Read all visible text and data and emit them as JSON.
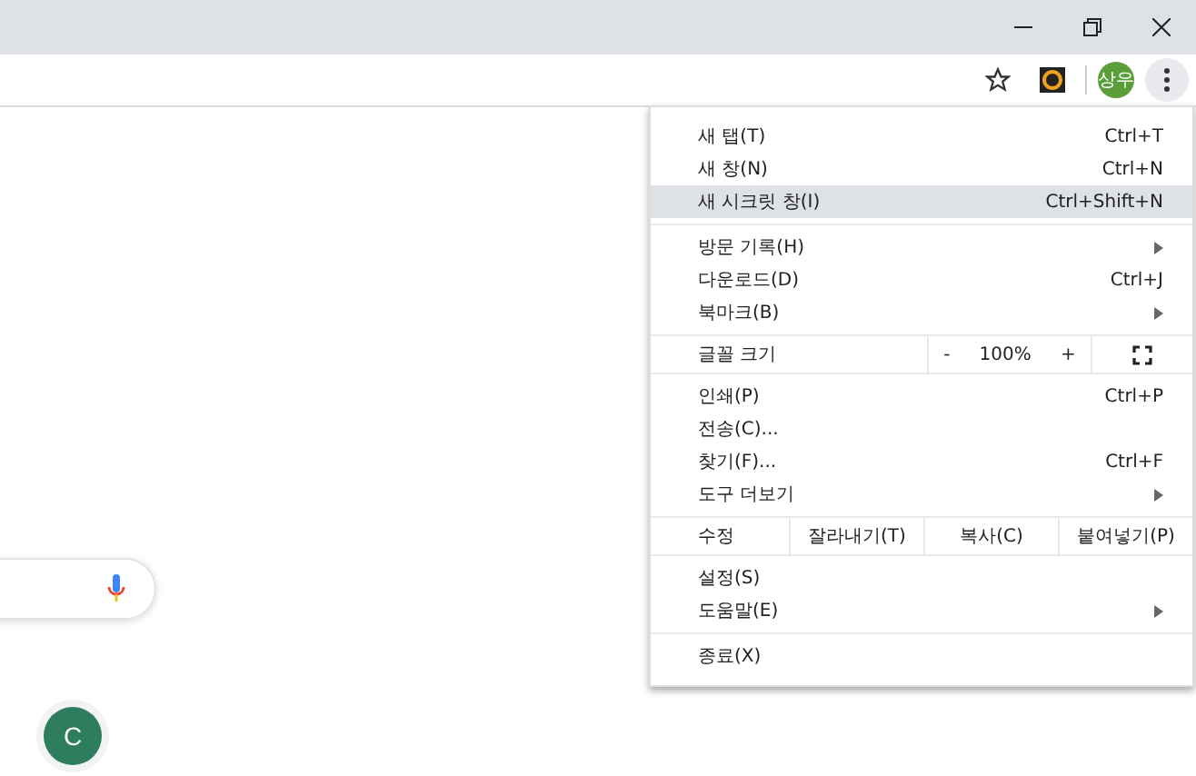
{
  "toolbar": {
    "avatar": "상우"
  },
  "menu": {
    "groups": [
      {
        "kind": "items",
        "items": [
          {
            "label": "새 탭(T)",
            "shortcut": "Ctrl+T",
            "submenu": false,
            "highlighted": false
          },
          {
            "label": "새 창(N)",
            "shortcut": "Ctrl+N",
            "submenu": false,
            "highlighted": false
          },
          {
            "label": "새 시크릿 창(I)",
            "shortcut": "Ctrl+Shift+N",
            "submenu": false,
            "highlighted": true
          }
        ]
      },
      {
        "kind": "items",
        "items": [
          {
            "label": "방문 기록(H)",
            "submenu": true,
            "highlighted": false
          },
          {
            "label": "다운로드(D)",
            "shortcut": "Ctrl+J",
            "submenu": false,
            "highlighted": false
          },
          {
            "label": "북마크(B)",
            "submenu": true,
            "highlighted": false
          }
        ]
      },
      {
        "kind": "zoom",
        "label": "글꼴 크기",
        "minus": "-",
        "value": "100%",
        "plus": "+"
      },
      {
        "kind": "items",
        "items": [
          {
            "label": "인쇄(P)",
            "shortcut": "Ctrl+P",
            "submenu": false,
            "highlighted": false
          },
          {
            "label": "전송(C)...",
            "submenu": false,
            "highlighted": false
          },
          {
            "label": "찾기(F)...",
            "shortcut": "Ctrl+F",
            "submenu": false,
            "highlighted": false
          },
          {
            "label": "도구 더보기",
            "submenu": true,
            "highlighted": false
          }
        ]
      },
      {
        "kind": "edit",
        "label": "수정",
        "buttons": [
          "잘라내기(T)",
          "복사(C)",
          "붙여넣기(P)"
        ]
      },
      {
        "kind": "items",
        "items": [
          {
            "label": "설정(S)",
            "submenu": false,
            "highlighted": false
          },
          {
            "label": "도움말(E)",
            "submenu": true,
            "highlighted": false
          }
        ]
      },
      {
        "kind": "items",
        "items": [
          {
            "label": "종료(X)",
            "submenu": false,
            "highlighted": false
          }
        ]
      }
    ]
  },
  "page": {
    "shortcut": "C"
  }
}
